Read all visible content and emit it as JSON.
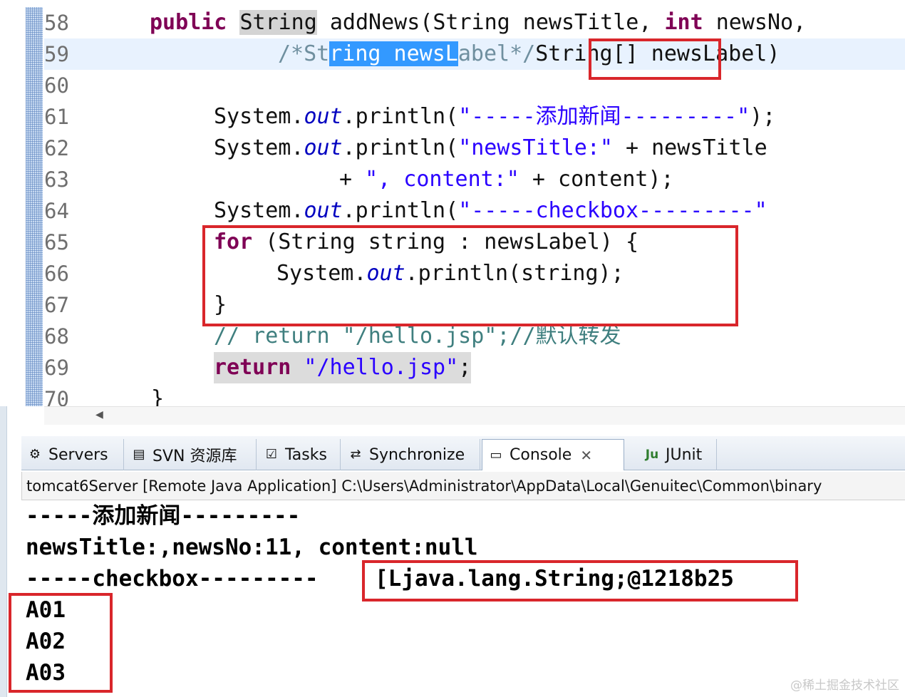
{
  "editor": {
    "lines": [
      {
        "no": "58"
      },
      {
        "no": "59"
      },
      {
        "no": "60"
      },
      {
        "no": "61"
      },
      {
        "no": "62"
      },
      {
        "no": "63"
      },
      {
        "no": "64"
      },
      {
        "no": "65"
      },
      {
        "no": "66"
      },
      {
        "no": "67"
      },
      {
        "no": "68"
      },
      {
        "no": "69"
      },
      {
        "no": "70"
      }
    ],
    "tokens": {
      "l58_public": "public",
      "l58_string": "String",
      "l58_rest": " addNews(String newsTitle, ",
      "l58_int": "int",
      "l58_tail": " newsNo,",
      "l59_c1": "/*St",
      "l59_sel": "ring newsL",
      "l59_c2": "abel*/",
      "l59_type": "String[]",
      "l59_tail": " newsLabel)",
      "l61_a": "System.",
      "l61_out": "out",
      "l61_b": ".println(",
      "l61_str": "\"-----添加新闻---------\"",
      "l61_c": ");",
      "l62_a": "System.",
      "l62_out": "out",
      "l62_b": ".println(",
      "l62_str": "\"newsTitle:\"",
      "l62_c": " + newsTitle",
      "l63_a": "+ ",
      "l63_str1": "\", content:\"",
      "l63_b": " + content);",
      "l64_a": "System.",
      "l64_out": "out",
      "l64_b": ".println(",
      "l64_str": "\"-----checkbox---------\"",
      "l65_for": "for",
      "l65_rest": " (String string : newsLabel) {",
      "l66_a": "System.",
      "l66_out": "out",
      "l66_b": ".println(string);",
      "l67": "}",
      "l68": "// return \"/hello.jsp\";//默认转发",
      "l69_ret": "return",
      "l69_str": " \"/hello.jsp\"",
      "l69_c": ";",
      "l70": "}"
    }
  },
  "tabs": [
    {
      "label": "Servers",
      "icon": "servers-icon",
      "glyph": "⚙"
    },
    {
      "label": "SVN 资源库",
      "icon": "svn-repository-icon",
      "glyph": "▤"
    },
    {
      "label": "Tasks",
      "icon": "tasks-icon",
      "glyph": "☑"
    },
    {
      "label": "Synchronize",
      "icon": "synchronize-icon",
      "glyph": "⇄"
    },
    {
      "label": "Console",
      "icon": "console-icon",
      "glyph": "▭",
      "close": "✕"
    },
    {
      "label": "JUnit",
      "icon": "junit-icon",
      "glyph": "Ju"
    }
  ],
  "console": {
    "title": "tomcat6Server [Remote Java Application] C:\\Users\\Administrator\\AppData\\Local\\Genuitec\\Common\\binary",
    "lines": [
      "-----添加新闻---------",
      "newsTitle:,newsNo:11, content:null",
      "-----checkbox---------",
      "[Ljava.lang.String;@1218b25",
      "A01",
      "A02",
      "A03"
    ]
  },
  "watermark": "@稀土掘金技术社区",
  "colors": {
    "keyword": "#7f0055",
    "string": "#2a00ff",
    "field": "#0000c0",
    "comment": "#3f7f7f",
    "annotation_box": "#d9262b",
    "selection": "#3399ff"
  }
}
